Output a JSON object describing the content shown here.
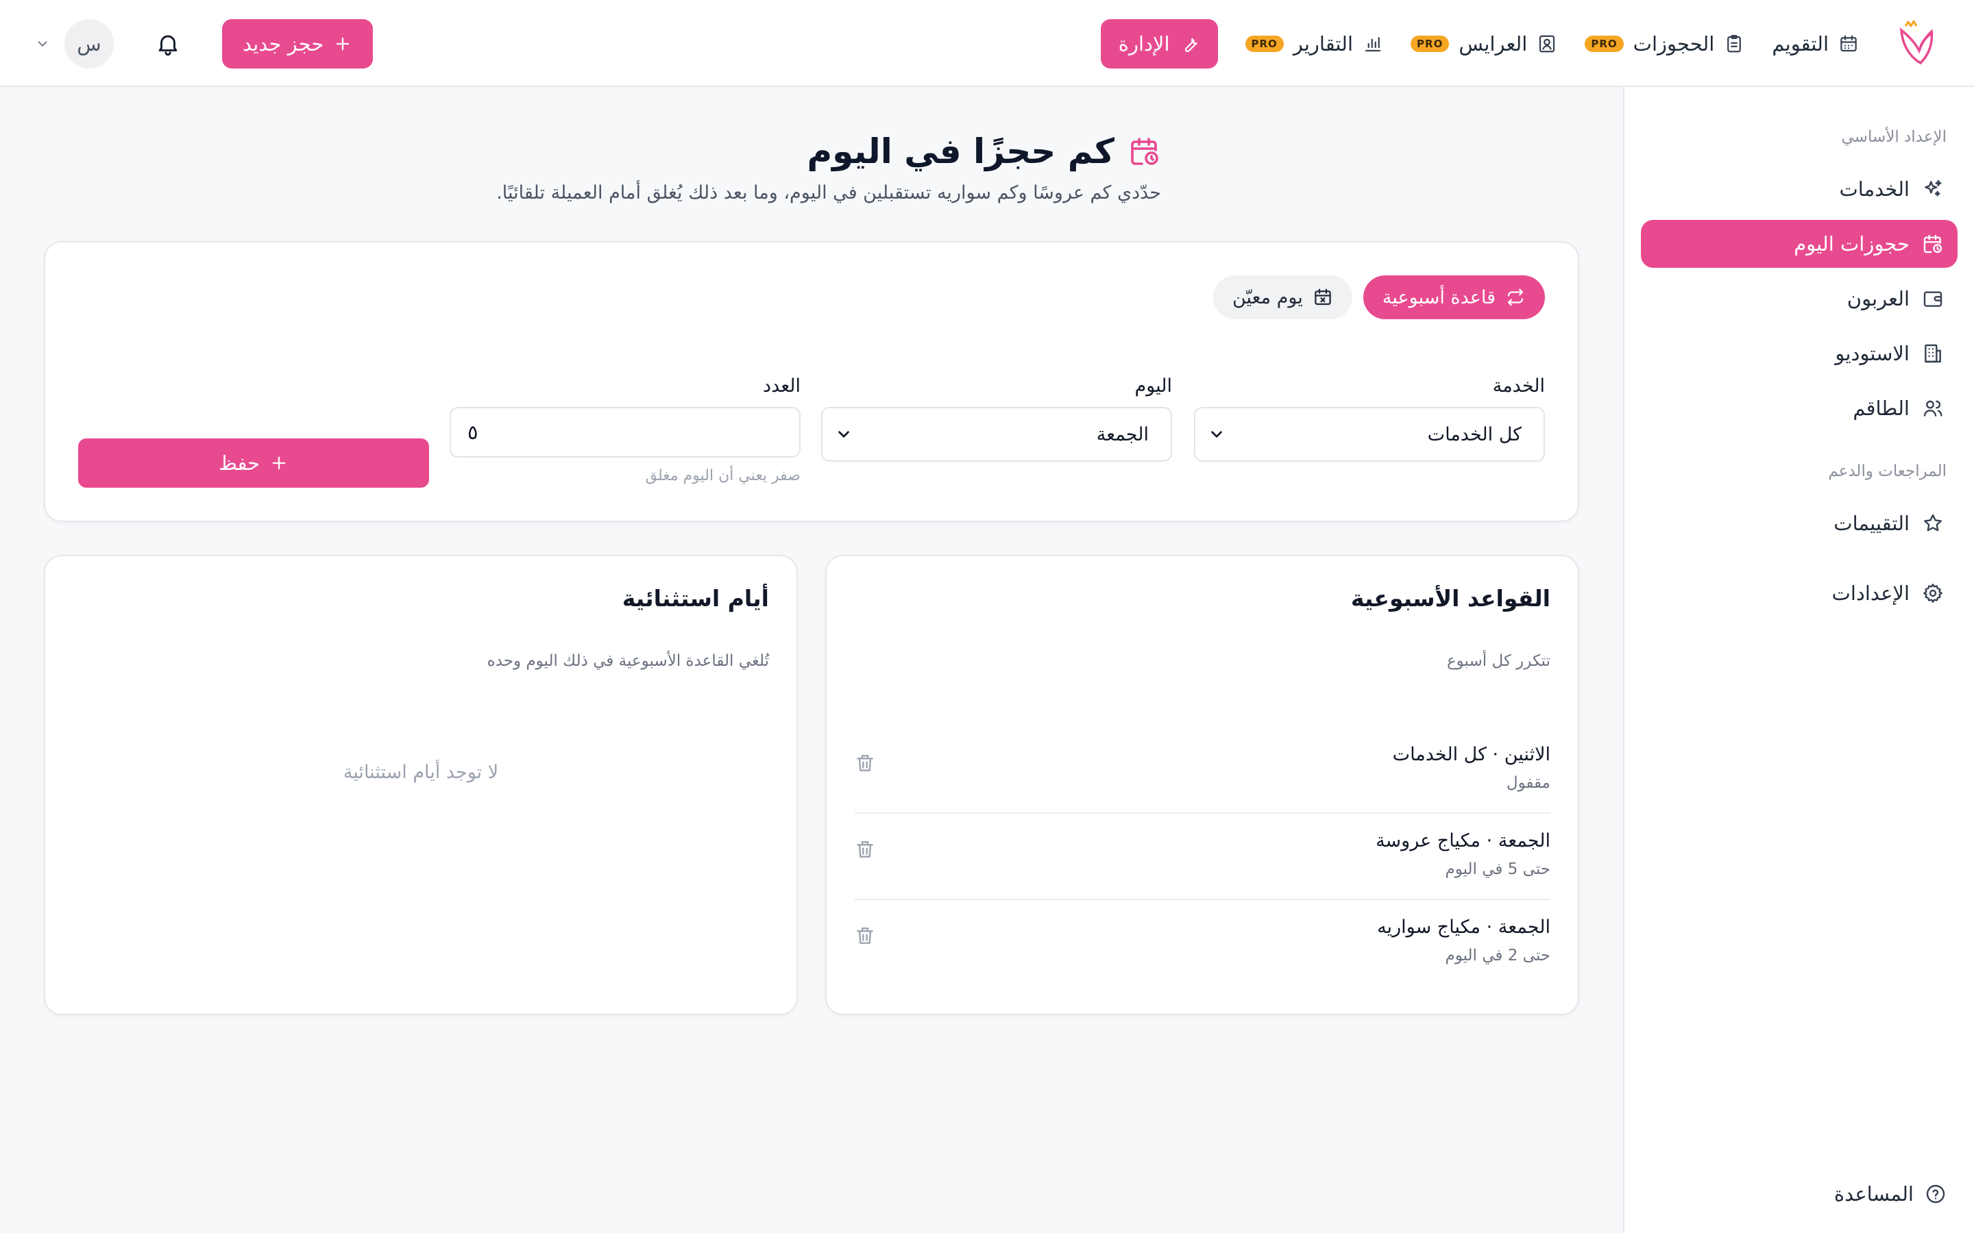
{
  "nav": {
    "items": [
      {
        "label": "التقويم",
        "icon": "calendar-icon"
      },
      {
        "label": "الحجوزات",
        "icon": "clipboard-icon",
        "badge": "PRO"
      },
      {
        "label": "العرايس",
        "icon": "contact-card-icon",
        "badge": "PRO"
      },
      {
        "label": "التقارير",
        "icon": "bar-chart-icon",
        "badge": "PRO"
      }
    ],
    "admin_label": "الإدارة",
    "new_booking_label": "حجز جديد",
    "avatar_initial": "س"
  },
  "sidebar": {
    "section_basic": "الإعداد الأساسي",
    "items_basic": [
      {
        "label": "الخدمات",
        "icon": "sparkles-icon"
      },
      {
        "label": "حجوزات اليوم",
        "icon": "calendar-clock-icon",
        "active": true
      },
      {
        "label": "العربون",
        "icon": "wallet-icon"
      },
      {
        "label": "الاستوديو",
        "icon": "building-icon"
      },
      {
        "label": "الطاقم",
        "icon": "users-icon"
      }
    ],
    "section_support": "المراجعات والدعم",
    "items_support": [
      {
        "label": "التقييمات",
        "icon": "star-icon"
      },
      {
        "label": "الإعدادات",
        "icon": "gear-icon"
      }
    ],
    "help_label": "المساعدة"
  },
  "page": {
    "title": "كم حجزًا في اليوم",
    "subtitle": "حدّدي كم عروسًا وكم سواريه تستقبلين في اليوم، وما بعد ذلك يُغلق أمام العميلة تلقائيًا."
  },
  "form": {
    "mode_weekly": "قاعدة أسبوعية",
    "mode_specific": "يوم معيّن",
    "service_label": "الخدمة",
    "service_value": "كل الخدمات",
    "day_label": "اليوم",
    "day_value": "الجمعة",
    "count_label": "العدد",
    "count_value": "٥",
    "count_hint": "صفر يعني أن اليوم مغلق",
    "save_label": "حفظ"
  },
  "weekly_rules": {
    "title": "القواعد الأسبوعية",
    "subtitle": "تتكرر كل أسبوع",
    "rows": [
      {
        "title": "الاثنين · كل الخدمات",
        "meta": "مقفول"
      },
      {
        "title": "الجمعة · مكياج عروسة",
        "meta": "حتى 5 في اليوم"
      },
      {
        "title": "الجمعة · مكياج سواريه",
        "meta": "حتى 2 في اليوم"
      }
    ]
  },
  "exceptions": {
    "title": "أيام استثنائية",
    "subtitle": "تُلغي القاعدة الأسبوعية في ذلك اليوم وحده",
    "empty": "لا توجد أيام استثنائية"
  },
  "colors": {
    "accent": "#e84a8f",
    "pro_badge": "#f5a623"
  }
}
